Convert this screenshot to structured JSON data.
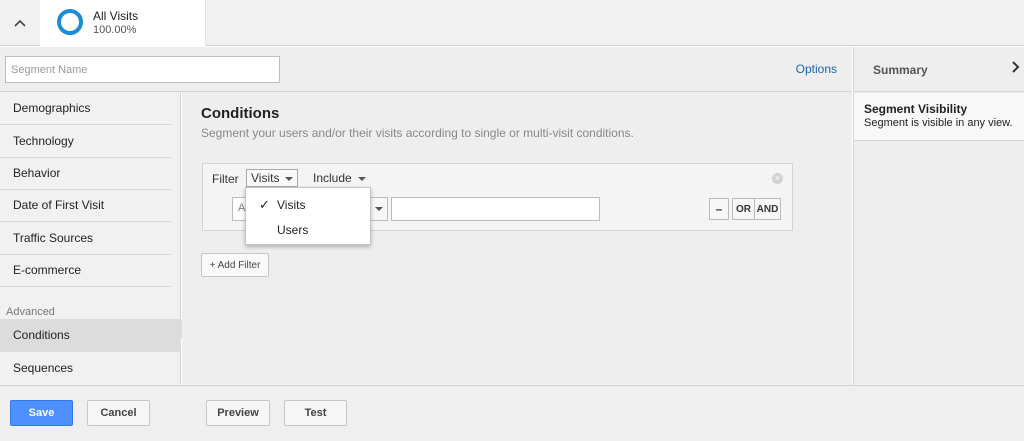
{
  "segment_card": {
    "name": "All Visits",
    "percent": "100.00%"
  },
  "name_row": {
    "placeholder": "Segment Name",
    "options_label": "Options"
  },
  "sidebar": {
    "items": [
      "Demographics",
      "Technology",
      "Behavior",
      "Date of First Visit",
      "Traffic Sources",
      "E-commerce"
    ],
    "advanced_label": "Advanced",
    "advanced_items": [
      "Conditions",
      "Sequences"
    ],
    "selected": "Conditions"
  },
  "main": {
    "title": "Conditions",
    "subtitle": "Segment your users and/or their visits according to single or multi-visit conditions.",
    "filter": {
      "label": "Filter",
      "scope_value": "Visits",
      "include_value": "Include",
      "dimension_partial": "A",
      "value": "",
      "remove_label": "–",
      "or_label": "OR",
      "and_label": "AND"
    },
    "add_filter_label": "+ Add Filter"
  },
  "scope_menu": {
    "options": [
      {
        "label": "Visits",
        "checked": true
      },
      {
        "label": "Users",
        "checked": false
      }
    ],
    "check_glyph": "✓"
  },
  "summary": {
    "title": "Summary",
    "visibility_title": "Segment Visibility",
    "visibility_text": "Segment is visible in any view."
  },
  "footer": {
    "save": "Save",
    "cancel": "Cancel",
    "preview": "Preview",
    "test": "Test"
  },
  "colors": {
    "accent_blue": "#4d90fe",
    "ring_blue": "#1a8dd6",
    "link_blue": "#1a65b2"
  }
}
